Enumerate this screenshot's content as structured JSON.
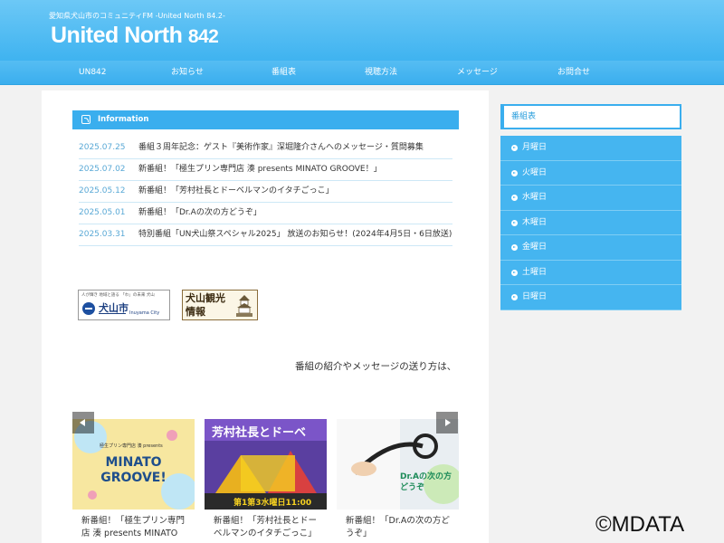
{
  "header": {
    "tagline": "愛知県犬山市のコミュニティFM -United North 84.2-",
    "logo_text": "United North",
    "logo_freq": "842"
  },
  "nav": {
    "items": [
      {
        "label": "UN842"
      },
      {
        "label": "お知らせ"
      },
      {
        "label": "番組表"
      },
      {
        "label": "視聴方法"
      },
      {
        "label": "メッセージ"
      },
      {
        "label": "お問合せ"
      }
    ]
  },
  "information": {
    "title": "Information",
    "icon": "rss-icon",
    "items": [
      {
        "date": "2025.07.25",
        "title": "番組３周年記念：ゲスト『美術作家』深堀隆介さんへのメッセージ・質問募集"
      },
      {
        "date": "2025.07.02",
        "title": "新番組！「極生プリン専門店 湊 presents MINATO GROOVE！」"
      },
      {
        "date": "2025.05.12",
        "title": "新番組！「芳村社長とドーベルマンのイタチごっこ」"
      },
      {
        "date": "2025.05.01",
        "title": "新番組！「Dr.Aの次の方どうぞ」"
      },
      {
        "date": "2025.03.31",
        "title": "特別番組「UN犬山祭スペシャル2025」 放送のお知らせ！(2024年4月5日・6日放送)"
      }
    ]
  },
  "banners": {
    "inuyama_city": {
      "small_text": "人が輝き 地域と語る 「わ」の未来 犬山",
      "name": "犬山市",
      "sub": "Inuyama City"
    },
    "tourism": {
      "text": "犬山観光情報"
    }
  },
  "marquee": {
    "text": "番組の紹介やメッセージの送り方は、各"
  },
  "carousel": {
    "slides": [
      {
        "caption": "新番組！「極生プリン専門店 湊 presents MINATO",
        "image_text": "MINATO GROOVE!",
        "image_small": "極生プリン専門店 湊 presents"
      },
      {
        "caption": "新番組！「芳村社長とドーベルマンのイタチごっこ」",
        "image_text": "芳村社長とドーベ",
        "image_small": "第1第3水曜日11:00"
      },
      {
        "caption": "新番組！「Dr.Aの次の方どうぞ」",
        "image_text": "Dr.Aの次の方どうぞ",
        "image_small": ""
      }
    ]
  },
  "sidebar": {
    "title": "番組表",
    "items": [
      {
        "label": "月曜日"
      },
      {
        "label": "火曜日"
      },
      {
        "label": "水曜日"
      },
      {
        "label": "木曜日"
      },
      {
        "label": "金曜日"
      },
      {
        "label": "土曜日"
      },
      {
        "label": "日曜日"
      }
    ]
  },
  "watermark": {
    "text": "©MDATA"
  },
  "colors": {
    "accent": "#3aaeee",
    "date": "#5aa9d6",
    "header_light": "#6cc8f6"
  }
}
